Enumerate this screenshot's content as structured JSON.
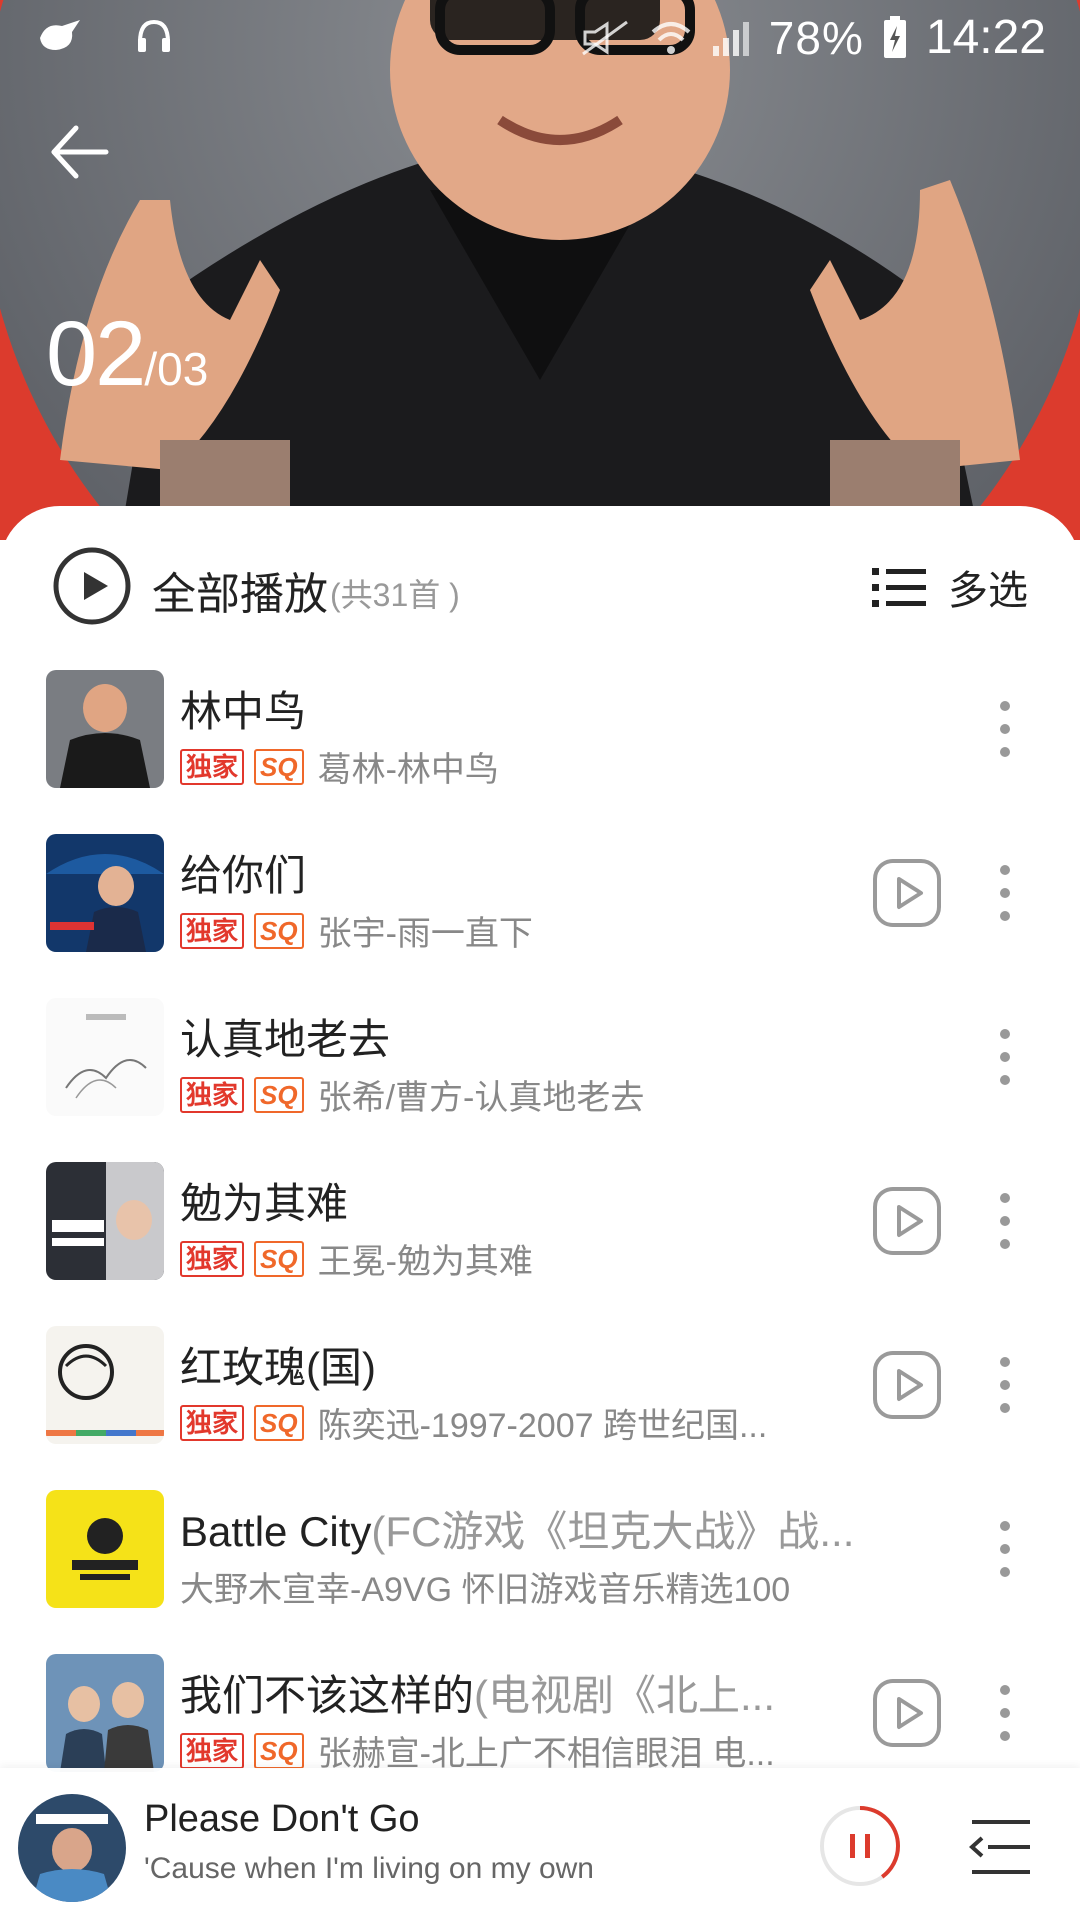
{
  "status_bar": {
    "battery": "78%",
    "time": "14:22",
    "icons": [
      "bird-icon",
      "headphones-icon",
      "mute-icon",
      "wifi-icon",
      "signal-icon",
      "battery-charging-icon"
    ]
  },
  "header": {
    "page_current": "02",
    "page_total": "/03"
  },
  "play_all": {
    "label": "全部播放",
    "count": "(共31首 )"
  },
  "multiselect_label": "多选",
  "badges": {
    "exclusive": "独家",
    "sq": "SQ"
  },
  "songs": [
    {
      "title": "林中鸟",
      "title_extra": "",
      "meta": "葛林-林中鸟",
      "badges": true,
      "mv": false
    },
    {
      "title": "给你们",
      "title_extra": "",
      "meta": "张宇-雨一直下",
      "badges": true,
      "mv": true
    },
    {
      "title": "认真地老去",
      "title_extra": "",
      "meta": "张希/曹方-认真地老去",
      "badges": true,
      "mv": false
    },
    {
      "title": "勉为其难",
      "title_extra": "",
      "meta": "王冕-勉为其难",
      "badges": true,
      "mv": true
    },
    {
      "title": "红玫瑰(国)",
      "title_extra": "",
      "meta": "陈奕迅-1997-2007 跨世纪国...",
      "badges": true,
      "mv": true
    },
    {
      "title": "Battle City",
      "title_extra": "(FC游戏《坦克大战》战...",
      "meta": "大野木宣幸-A9VG 怀旧游戏音乐精选100",
      "badges": false,
      "mv": false
    },
    {
      "title": "我们不该这样的",
      "title_extra": "(电视剧《北上...",
      "meta": "张赫宣-北上广不相信眼泪 电...",
      "badges": true,
      "mv": true
    }
  ],
  "player": {
    "title": "Please Don't Go",
    "lyric": "'Cause when I'm living on my own",
    "progress": 0.4
  },
  "colors": {
    "accent": "#dc3b2d",
    "badge_exclusive": "#e2382c",
    "badge_sq": "#f0682a"
  }
}
